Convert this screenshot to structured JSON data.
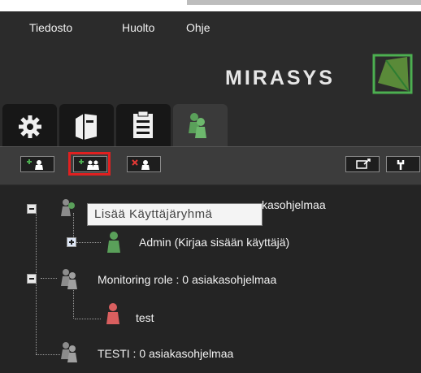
{
  "menu": {
    "items": [
      "Tiedosto",
      "Huolto",
      "Ohje"
    ]
  },
  "logo": {
    "text": "MIRASYS",
    "color": "#4caf50"
  },
  "tabs": [
    {
      "icon": "gear-icon"
    },
    {
      "icon": "server-icon"
    },
    {
      "icon": "clipboard-icon"
    },
    {
      "icon": "users-icon",
      "active": true
    }
  ],
  "toolbar": {
    "buttons": [
      {
        "icon": "add-user-icon"
      },
      {
        "icon": "add-user-group-icon",
        "highlighted": true
      },
      {
        "icon": "delete-user-icon"
      },
      {
        "icon": "export-icon"
      },
      {
        "icon": "settings-icon"
      }
    ]
  },
  "tooltip": {
    "text": "Lisää Käyttäjäryhmä"
  },
  "tree": {
    "rows": [
      {
        "label": "kasohjelmaa"
      },
      {
        "label": "Admin (Kirjaa sisään käyttäjä)"
      },
      {
        "label": "Monitoring role : 0 asiakasohjelmaa"
      },
      {
        "label": "test"
      },
      {
        "label": "TESTI : 0 asiakasohjelmaa"
      }
    ]
  },
  "colors": {
    "accent": "#e02020",
    "user_green": "#5aa05a",
    "user_red": "#d95f5f",
    "user_gray": "#8c8c8c"
  }
}
